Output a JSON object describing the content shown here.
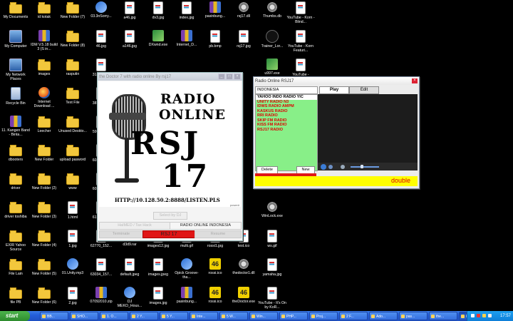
{
  "desktop_icons": [
    {
      "label": "My Documents",
      "icon": "folder"
    },
    {
      "label": "id kotak",
      "icon": "folder"
    },
    {
      "label": "New Folder (7)",
      "icon": "folder"
    },
    {
      "label": "03.3nSorry...",
      "icon": "media"
    },
    {
      "label": "a46.jpg",
      "icon": "doc"
    },
    {
      "label": "dv3.jpg",
      "icon": "doc"
    },
    {
      "label": "index.jpg",
      "icon": "doc"
    },
    {
      "label": "pasinbung...",
      "icon": "zip"
    },
    {
      "label": "rsj17.dll",
      "icon": "gear"
    },
    {
      "label": "Thumbs.db",
      "icon": "gear"
    },
    {
      "label": "YouTube - Korn - Blind...",
      "icon": "doc"
    },
    {
      "label": "My Computer",
      "icon": "pc"
    },
    {
      "label": "IDM V.5.18 build 3 (S in...",
      "icon": "zip"
    },
    {
      "label": "New Folder (8)",
      "icon": "folder"
    },
    {
      "label": "46.jpg",
      "icon": "doc"
    },
    {
      "label": "a146.jpg",
      "icon": "doc"
    },
    {
      "label": "DXwnd.exe",
      "icon": "app"
    },
    {
      "label": "Internet_D...",
      "icon": "zip"
    },
    {
      "label": "pb.bmp",
      "icon": "doc"
    },
    {
      "label": "rsj17.jpg",
      "icon": "doc"
    },
    {
      "label": "Trainer_Lor...",
      "icon": "black"
    },
    {
      "label": "YouTube - Korn Featuri...",
      "icon": "doc"
    },
    {
      "label": "My Network Places",
      "icon": "pc"
    },
    {
      "label": "images",
      "icon": "folder"
    },
    {
      "label": "rasputin",
      "icon": "folder"
    },
    {
      "label": "31389_1...",
      "icon": "doc"
    },
    {
      "label": "u997.exe",
      "icon": "app"
    },
    {
      "label": "YouTube -",
      "icon": "doc"
    },
    {
      "label": "Recycle Bin",
      "icon": "bin"
    },
    {
      "label": "Internet Download ...",
      "icon": "fire"
    },
    {
      "label": "Text File",
      "icon": "folder"
    },
    {
      "label": "38743_1...",
      "icon": "doc"
    },
    {
      "label": "11. Kangen Band - Binta...",
      "icon": "zip"
    },
    {
      "label": "Leecher",
      "icon": "folder"
    },
    {
      "label": "Unused Deskto...",
      "icon": "folder"
    },
    {
      "label": "59011_1...",
      "icon": "doc"
    },
    {
      "label": "dbooters",
      "icon": "folder"
    },
    {
      "label": "New Folder",
      "icon": "folder"
    },
    {
      "label": "upload pasword",
      "icon": "folder"
    },
    {
      "label": "60251_1...",
      "icon": "doc"
    },
    {
      "label": "driver",
      "icon": "folder"
    },
    {
      "label": "New Folder (2)",
      "icon": "folder"
    },
    {
      "label": "www",
      "icon": "folder"
    },
    {
      "label": "60317_1...",
      "icon": "doc"
    },
    {
      "label": "driver toshiba",
      "icon": "folder"
    },
    {
      "label": "New Folder (3)",
      "icon": "folder"
    },
    {
      "label": "1.html",
      "icon": "doc"
    },
    {
      "label": "61704_1...",
      "icon": "doc"
    },
    {
      "label": "WinLock.exe",
      "icon": "gear"
    },
    {
      "label": "EXIR Yahoo Source",
      "icon": "folder"
    },
    {
      "label": "New Folder (4)",
      "icon": "folder"
    },
    {
      "label": "1.jpg",
      "icon": "doc"
    },
    {
      "label": "62770_152...",
      "icon": "doc"
    },
    {
      "label": "d3d9.rar",
      "icon": "zip"
    },
    {
      "label": "images12.jpg",
      "icon": "doc"
    },
    {
      "label": "multi.gif",
      "icon": "doc"
    },
    {
      "label": "rossi1.jpg",
      "icon": "doc"
    },
    {
      "label": "test.ico",
      "icon": "doc"
    },
    {
      "label": "ws.gif",
      "icon": "doc"
    },
    {
      "label": "File Lain",
      "icon": "folder"
    },
    {
      "label": "New Folder (5)",
      "icon": "folder"
    },
    {
      "label": "01.Unity.mp3",
      "icon": "media"
    },
    {
      "label": "63034_157...",
      "icon": "doc"
    },
    {
      "label": "default.jpeg",
      "icon": "doc"
    },
    {
      "label": "images.jpeg",
      "icon": "doc"
    },
    {
      "label": "Opick Groove-tha...",
      "icon": "media"
    },
    {
      "label": "rossi.ico",
      "icon": "yellow"
    },
    {
      "label": "thedoctor1.dll",
      "icon": "gear"
    },
    {
      "label": "yamaha.jpg",
      "icon": "doc"
    },
    {
      "label": "file PB",
      "icon": "folder"
    },
    {
      "label": "New Folder (6)",
      "icon": "folder"
    },
    {
      "label": "2.jpg",
      "icon": "doc"
    },
    {
      "label": "07092010.zip",
      "icon": "zip"
    },
    {
      "label": "DJ MEKO_Hous...",
      "icon": "media"
    },
    {
      "label": "images.jpg",
      "icon": "doc"
    },
    {
      "label": "pasinbung...",
      "icon": "zip"
    },
    {
      "label": "rossi.ico",
      "icon": "yellow"
    },
    {
      "label": "theDoctor.exe",
      "icon": "yellow"
    },
    {
      "label": "YouTube - It's On by KoR...",
      "icon": "doc"
    }
  ],
  "doctor_window": {
    "title": "the Doctor 7 with radio online By rsj17",
    "art_line1": "RADIO",
    "art_line2": "ONLINE",
    "art_line3": "RSJ",
    "art_line4": "17",
    "art_url": "HTTP://10.128.50.2:8888/LISTEN.PLS",
    "powered": "power#",
    "select_button": "Select by DJ",
    "halmed_button": "HalMED / Tax Hack",
    "indo_button": "RADIO ONLINE INDONESIA",
    "terminate_button": "Terminate",
    "rsj_button": "RSJ 17",
    "resume_button": "Resume"
  },
  "radio_window": {
    "title": "Radio Online RSJ17",
    "search_value": "INDONESIA",
    "stations": [
      "YAHOO INDO RADIO YIC",
      "UNITY RADIO N3",
      "IDWS RADIO AMPM",
      "KASKUS RADIO",
      "RRI RADIO",
      "SKIP FM RADIO",
      "KISS FM RADIO",
      "RSJ17 RADIO"
    ],
    "selected_index": 0,
    "tab_play": "Play",
    "tab_edit": "Edit",
    "delete_button": "Delete",
    "new_button": "New",
    "status_text": "double",
    "volume_level": 0.4
  },
  "taskbar": {
    "start_label": "start",
    "buttons": [
      "BB...",
      "SHO...",
      "1. O...",
      "2 Y...",
      "5 Y...",
      "Inte...",
      "5 W...",
      "Win...",
      "PHP...",
      "Proj...",
      "2 F...",
      "Ado...",
      "pas...",
      "the...",
      "Radi..."
    ],
    "active_index": 14,
    "clock": "17:57"
  },
  "colors": {
    "accent_red": "#e01616",
    "station_green": "#88ef88",
    "status_yellow": "#ffff00",
    "taskbar_blue": "#245edb"
  }
}
